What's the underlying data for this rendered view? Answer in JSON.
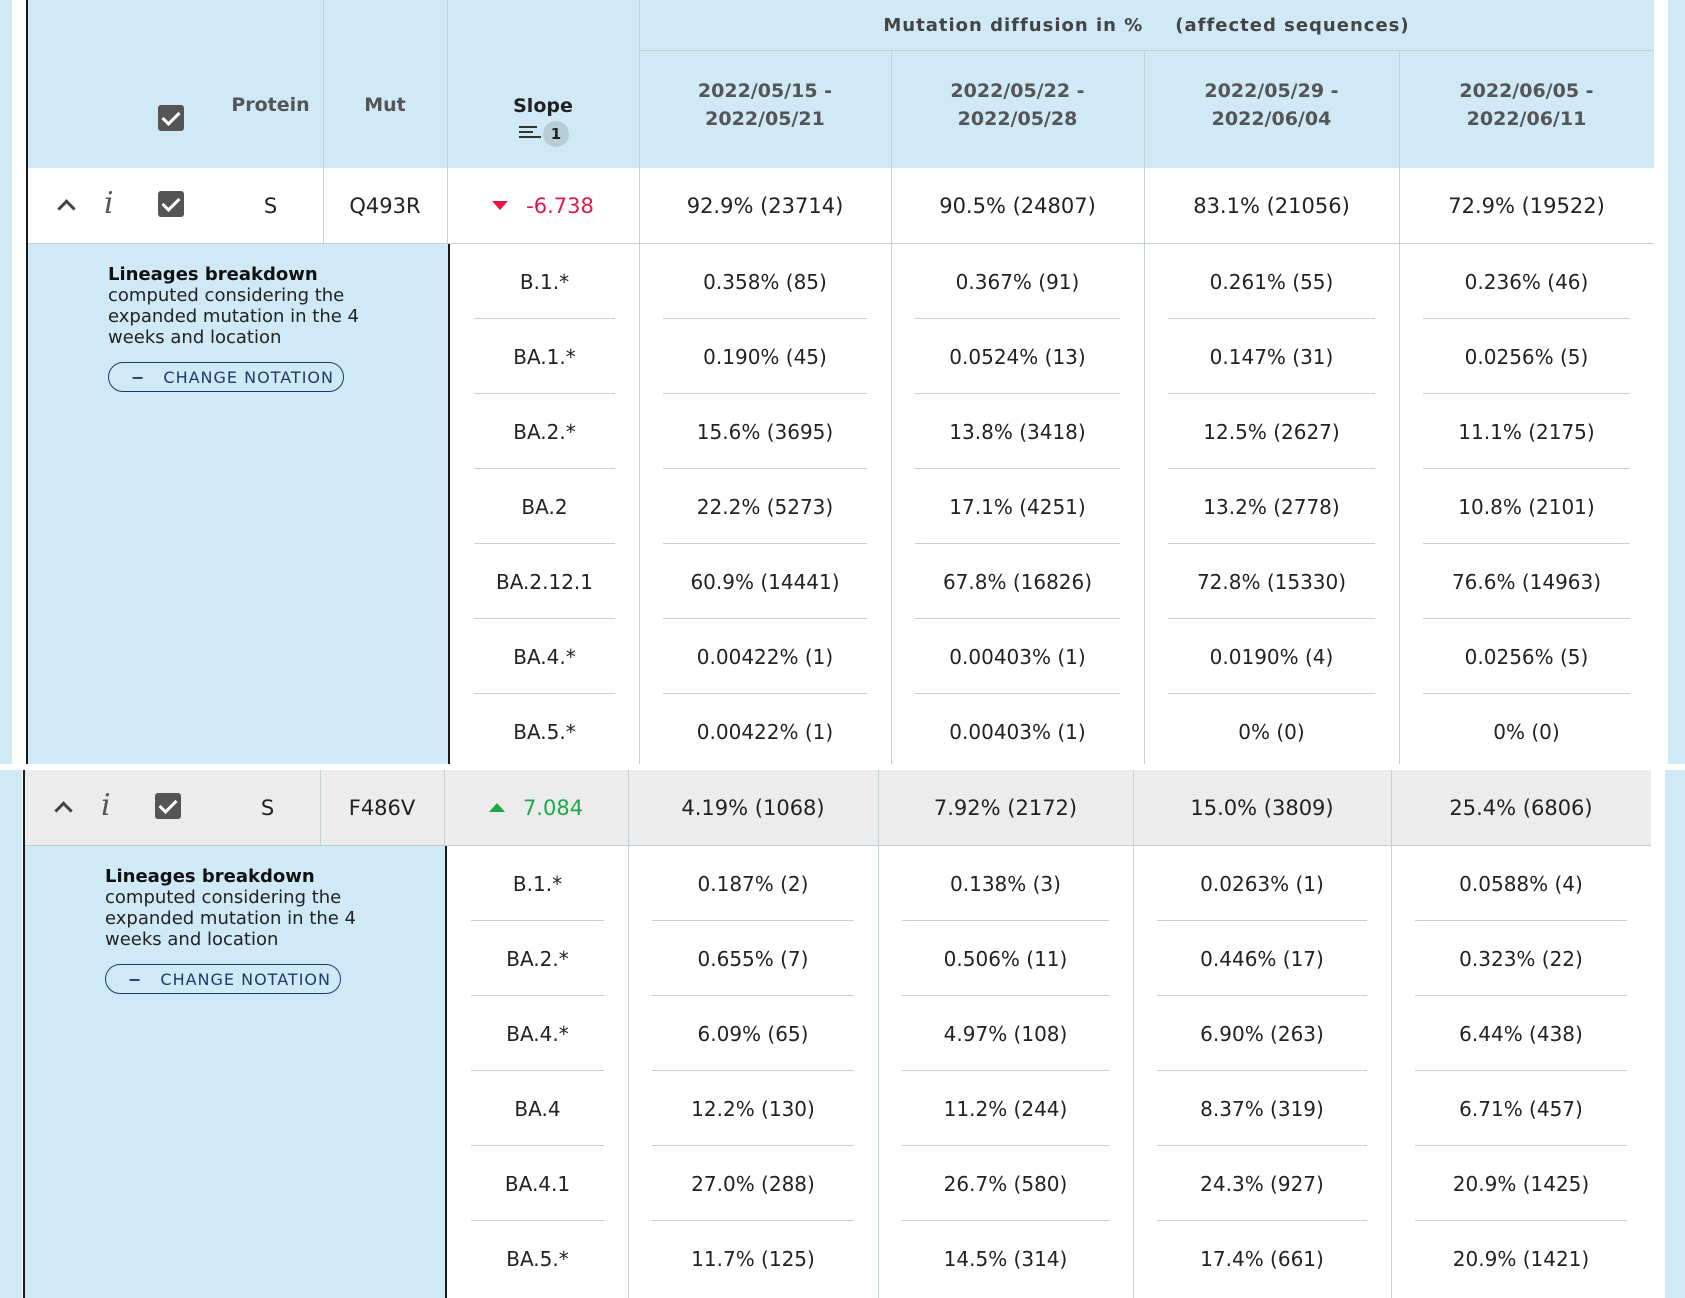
{
  "header": {
    "group_title_left": "Mutation diffusion in %",
    "group_title_right": "(affected sequences)",
    "protein": "Protein",
    "mut": "Mut",
    "slope": "Slope",
    "slope_sort_badge": "1",
    "weeks": [
      {
        "line1": "2022/05/15 -",
        "line2": "2022/05/21"
      },
      {
        "line1": "2022/05/22 -",
        "line2": "2022/05/28"
      },
      {
        "line1": "2022/05/29 -",
        "line2": "2022/06/04"
      },
      {
        "line1": "2022/06/05 -",
        "line2": "2022/06/11"
      }
    ]
  },
  "colors": {
    "header_bg": "#cfe9f6",
    "slope_negative": "#e0184d",
    "slope_positive": "#1fa84a",
    "button_border": "#1d3a6b",
    "highlight_row": "#ececec"
  },
  "icons": {
    "collapse": "chevron-up-icon",
    "info": "info-icon",
    "checkbox": "checkbox-checked-icon",
    "sort": "sort-icon",
    "slope_down": "triangle-down-icon",
    "slope_up": "triangle-up-icon"
  },
  "rows": [
    {
      "protein": "S",
      "mut": "Q493R",
      "slope": "-6.738",
      "values": [
        "92.9% (23714)",
        "90.5% (24807)",
        "83.1% (21056)",
        "72.9% (19522)"
      ],
      "breakdown_title": "Lineages breakdown",
      "breakdown_text": "computed considering the expanded mutation in the 4 weeks and location",
      "notation_button": "CHANGE NOTATION",
      "notation_symbol": "−",
      "lineages": [
        {
          "name": "B.1.*",
          "values": [
            "0.358% (85)",
            "0.367% (91)",
            "0.261% (55)",
            "0.236% (46)"
          ]
        },
        {
          "name": "BA.1.*",
          "values": [
            "0.190% (45)",
            "0.0524% (13)",
            "0.147% (31)",
            "0.0256% (5)"
          ]
        },
        {
          "name": "BA.2.*",
          "values": [
            "15.6% (3695)",
            "13.8% (3418)",
            "12.5% (2627)",
            "11.1% (2175)"
          ]
        },
        {
          "name": "BA.2",
          "values": [
            "22.2% (5273)",
            "17.1% (4251)",
            "13.2% (2778)",
            "10.8% (2101)"
          ]
        },
        {
          "name": "BA.2.12.1",
          "values": [
            "60.9% (14441)",
            "67.8% (16826)",
            "72.8% (15330)",
            "76.6% (14963)"
          ]
        },
        {
          "name": "BA.4.*",
          "values": [
            "0.00422% (1)",
            "0.00403% (1)",
            "0.0190% (4)",
            "0.0256% (5)"
          ]
        },
        {
          "name": "BA.5.*",
          "values": [
            "0.00422% (1)",
            "0.00403% (1)",
            "0% (0)",
            "0% (0)"
          ]
        }
      ]
    },
    {
      "protein": "S",
      "mut": "F486V",
      "slope": "7.084",
      "values": [
        "4.19% (1068)",
        "7.92% (2172)",
        "15.0% (3809)",
        "25.4% (6806)"
      ],
      "breakdown_title": "Lineages breakdown",
      "breakdown_text": "computed considering the expanded mutation in the 4 weeks and location",
      "notation_button": "CHANGE NOTATION",
      "notation_symbol": "−",
      "lineages": [
        {
          "name": "B.1.*",
          "values": [
            "0.187% (2)",
            "0.138% (3)",
            "0.0263% (1)",
            "0.0588% (4)"
          ]
        },
        {
          "name": "BA.2.*",
          "values": [
            "0.655% (7)",
            "0.506% (11)",
            "0.446% (17)",
            "0.323% (22)"
          ]
        },
        {
          "name": "BA.4.*",
          "values": [
            "6.09% (65)",
            "4.97% (108)",
            "6.90% (263)",
            "6.44% (438)"
          ]
        },
        {
          "name": "BA.4",
          "values": [
            "12.2% (130)",
            "11.2% (244)",
            "8.37% (319)",
            "6.71% (457)"
          ]
        },
        {
          "name": "BA.4.1",
          "values": [
            "27.0% (288)",
            "26.7% (580)",
            "24.3% (927)",
            "20.9% (1425)"
          ]
        },
        {
          "name": "BA.5.*",
          "values": [
            "11.7% (125)",
            "14.5% (314)",
            "17.4% (661)",
            "20.9% (1421)"
          ]
        }
      ]
    }
  ]
}
